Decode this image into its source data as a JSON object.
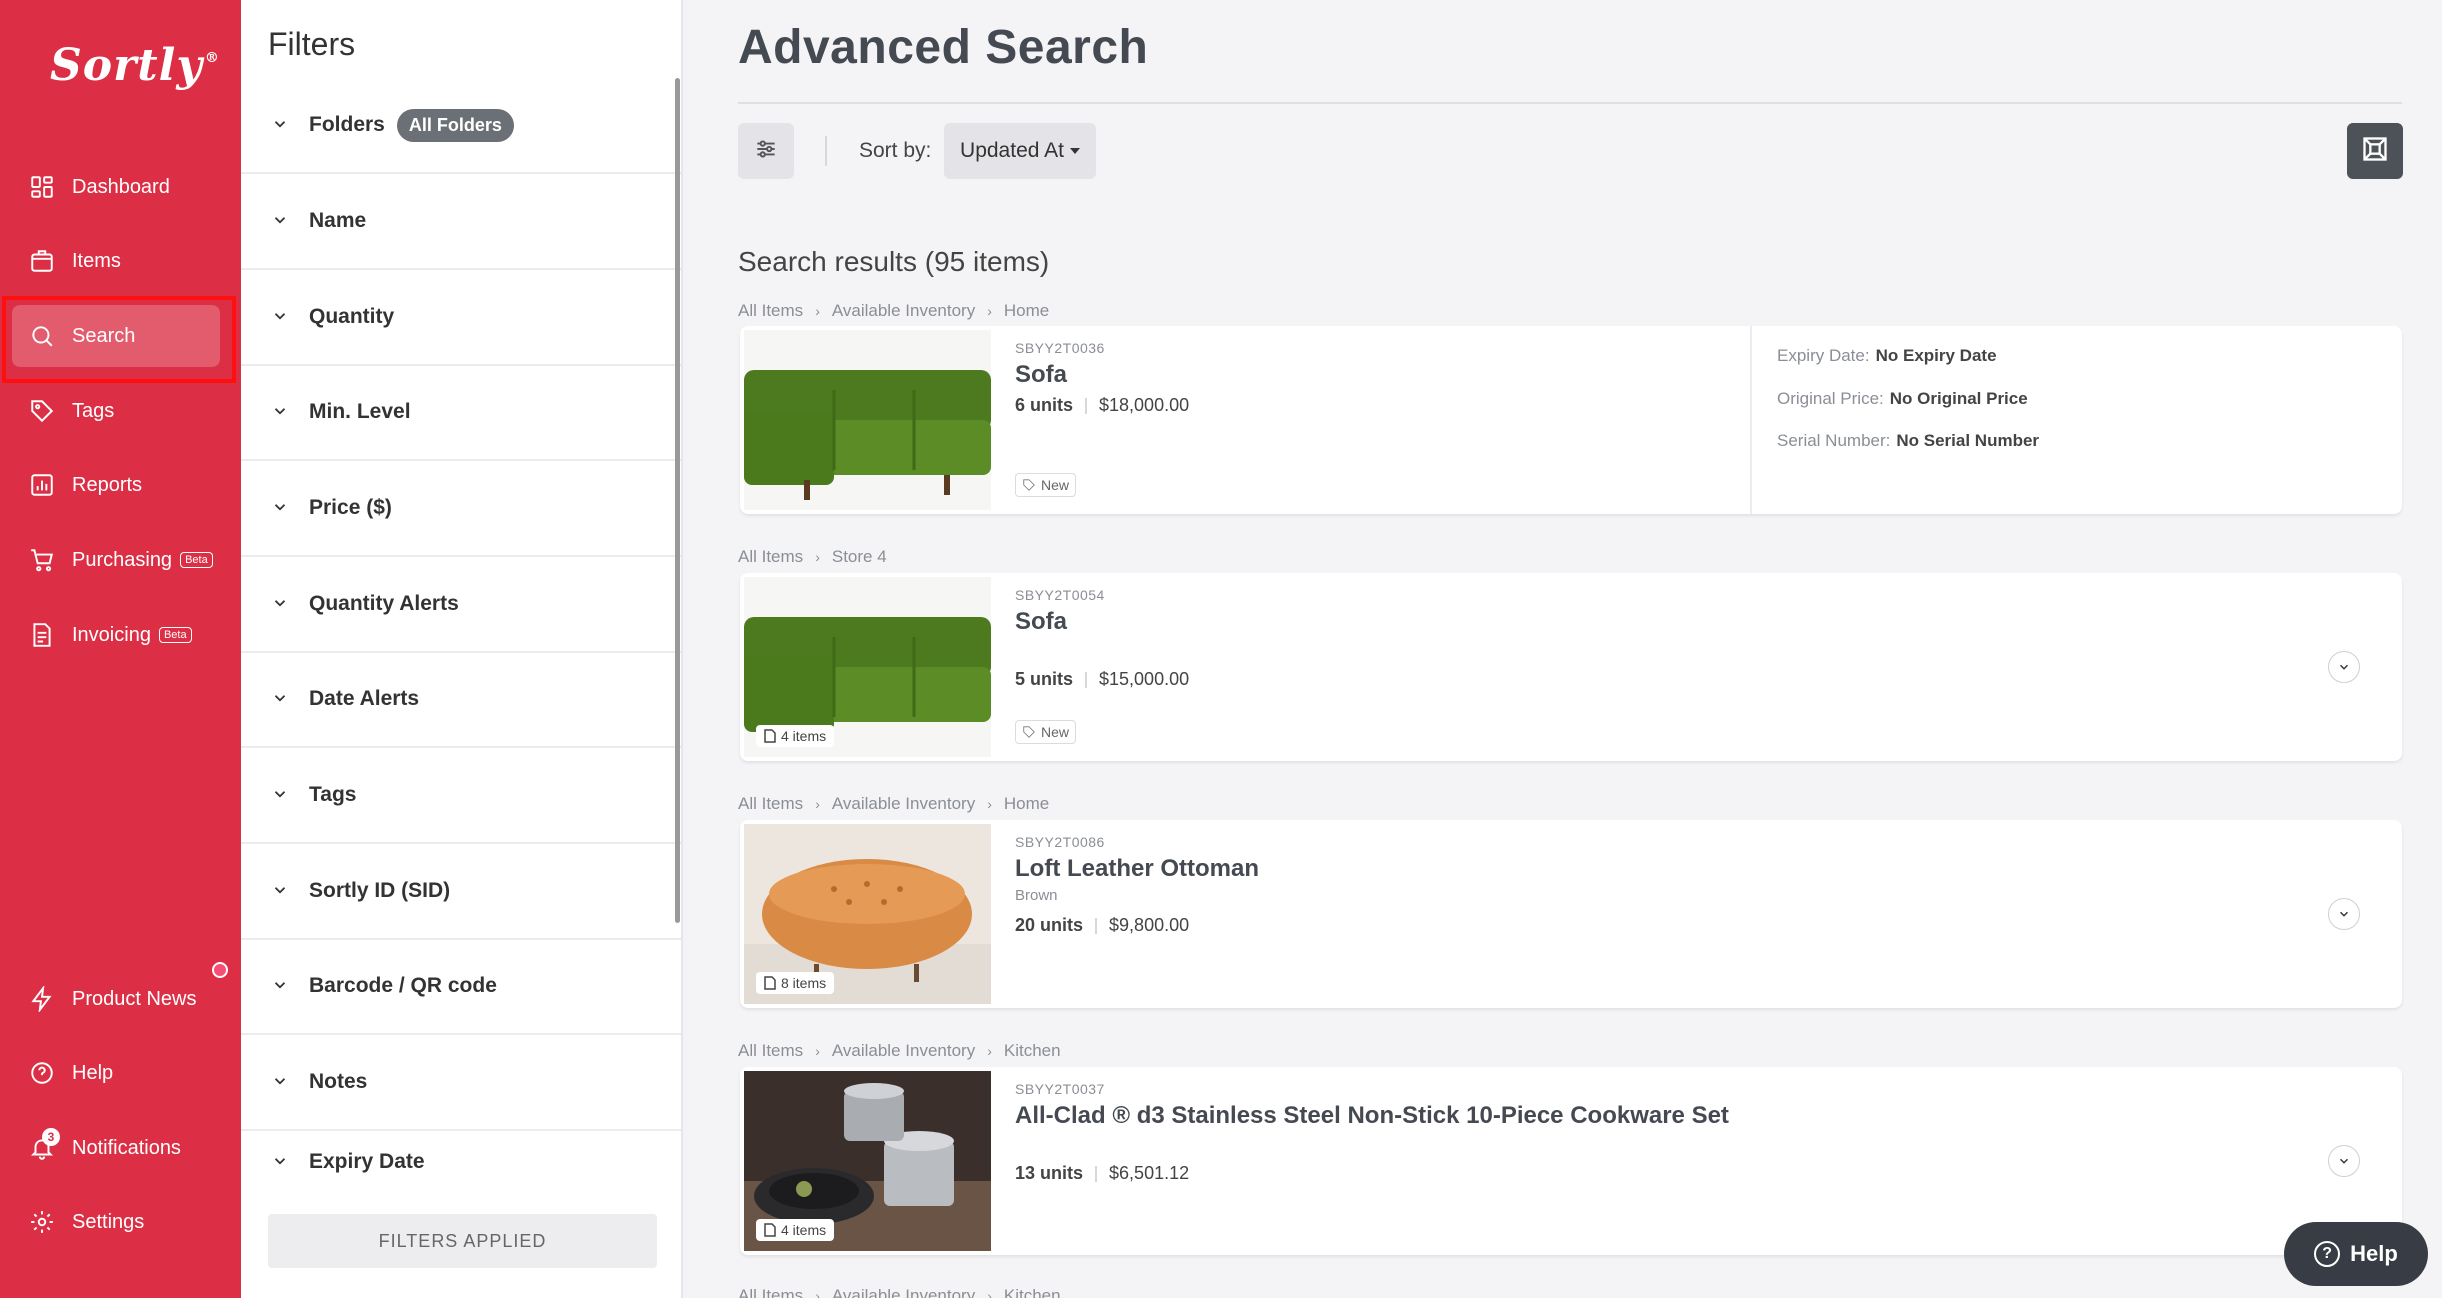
{
  "brand": {
    "logo_text": "Sortly",
    "logo_mark": "®"
  },
  "sidebar": {
    "items": [
      {
        "label": "Dashboard",
        "icon": "dashboard-icon"
      },
      {
        "label": "Items",
        "icon": "items-icon"
      },
      {
        "label": "Search",
        "icon": "search-icon",
        "active": true
      },
      {
        "label": "Tags",
        "icon": "tag-icon"
      },
      {
        "label": "Reports",
        "icon": "reports-icon"
      },
      {
        "label": "Purchasing",
        "icon": "cart-icon",
        "badge": "Beta"
      },
      {
        "label": "Invoicing",
        "icon": "invoice-icon",
        "badge": "Beta"
      }
    ],
    "bottom": [
      {
        "label": "Product News",
        "icon": "bolt-icon"
      },
      {
        "label": "Help",
        "icon": "help-icon"
      },
      {
        "label": "Notifications",
        "icon": "bell-icon",
        "count": "3"
      },
      {
        "label": "Settings",
        "icon": "gear-icon"
      }
    ]
  },
  "filters": {
    "title": "Filters",
    "rows": [
      {
        "label": "Folders",
        "pill": "All Folders"
      },
      {
        "label": "Name"
      },
      {
        "label": "Quantity"
      },
      {
        "label": "Min. Level"
      },
      {
        "label": "Price ($)"
      },
      {
        "label": "Quantity Alerts"
      },
      {
        "label": "Date Alerts"
      },
      {
        "label": "Tags"
      },
      {
        "label": "Sortly ID (SID)"
      },
      {
        "label": "Barcode / QR code"
      },
      {
        "label": "Notes"
      },
      {
        "label": "Expiry Date"
      }
    ],
    "applied_button": "FILTERS APPLIED"
  },
  "main": {
    "title": "Advanced Search",
    "sort_label": "Sort by:",
    "sort_value": "Updated At",
    "results_title": "Search results (95 items)",
    "results": [
      {
        "breadcrumb": [
          "All Items",
          "Available Inventory",
          "Home"
        ],
        "sid": "SBYY2T0036",
        "name": "Sofa",
        "qty": "6 units",
        "price": "$18,000.00",
        "tag": "New",
        "fields": [
          {
            "label": "Expiry Date:",
            "value": "No Expiry Date"
          },
          {
            "label": "Original Price:",
            "value": "No Original Price"
          },
          {
            "label": "Serial Number:",
            "value": "No Serial Number"
          }
        ]
      },
      {
        "breadcrumb": [
          "All Items",
          "Store 4"
        ],
        "sid": "SBYY2T0054",
        "name": "Sofa",
        "qty": "5 units",
        "price": "$15,000.00",
        "tag": "New",
        "badge": "4 items"
      },
      {
        "breadcrumb": [
          "All Items",
          "Available Inventory",
          "Home"
        ],
        "sid": "SBYY2T0086",
        "name": "Loft Leather Ottoman",
        "variant": "Brown",
        "qty": "20 units",
        "price": "$9,800.00",
        "badge": "8 items"
      },
      {
        "breadcrumb": [
          "All Items",
          "Available Inventory",
          "Kitchen"
        ],
        "sid": "SBYY2T0037",
        "name": "All-Clad ® d3 Stainless Steel Non-Stick 10-Piece Cookware Set",
        "qty": "13 units",
        "price": "$6,501.12",
        "badge": "4 items"
      },
      {
        "breadcrumb": [
          "All Items",
          "Available Inventory",
          "Kitchen"
        ]
      }
    ]
  },
  "help_fab": "Help",
  "colors": {
    "sidebar": "#dc2f45",
    "accent_highlight": "#ff1010"
  }
}
